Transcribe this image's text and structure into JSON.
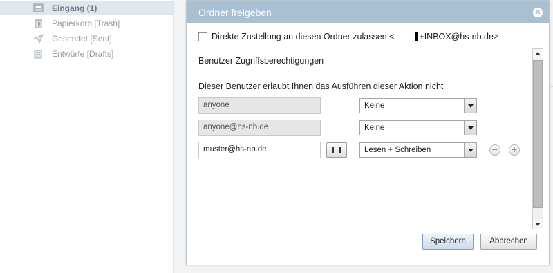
{
  "folders": [
    {
      "label": "Eingang (1)",
      "icon": "inbox-icon",
      "selected": true
    },
    {
      "label": "Papierkorb [Trash]",
      "icon": "trash-icon",
      "selected": false
    },
    {
      "label": "Gesendet [Sent]",
      "icon": "sent-icon",
      "selected": false
    },
    {
      "label": "Entwürfe [Drafts]",
      "icon": "drafts-icon",
      "selected": false
    }
  ],
  "dialog": {
    "title": "Ordner freigeben",
    "close_icon": "close-icon",
    "direct_delivery": {
      "checked": false,
      "label_prefix": "Direkte Zustellung an diesen Ordner zulassen <",
      "label_suffix": "+INBOX@hs-nb.de>"
    },
    "section_title": "Benutzer Zugriffsberechtigungen",
    "info_text": "Dieser Benutzer erlaubt Ihnen das Ausführen dieser Aktion nicht",
    "permissions": [
      {
        "user": "anyone",
        "right": "Keine",
        "editable": false
      },
      {
        "user": "anyone@hs-nb.de",
        "right": "Keine",
        "editable": false
      },
      {
        "user": "muster@hs-nb.de",
        "right": "Lesen + Schreiben",
        "editable": true
      }
    ],
    "buttons": {
      "save": "Speichern",
      "cancel": "Abbrechen"
    }
  },
  "colors": {
    "header": "#a9c0d3",
    "selected_folder": "#dfe6ec"
  }
}
